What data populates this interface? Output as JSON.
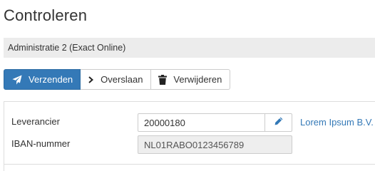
{
  "page": {
    "title": "Controleren"
  },
  "administration": {
    "label": "Administratie 2 (Exact Online)"
  },
  "toolbar": {
    "send_label": "Verzenden",
    "skip_label": "Overslaan",
    "delete_label": "Verwijderen",
    "send_icon": "paper-plane-icon",
    "skip_icon": "chevron-right-icon",
    "delete_icon": "trash-icon",
    "primary_color": "#3479b7"
  },
  "form": {
    "supplier": {
      "label": "Leverancier",
      "value": "20000180",
      "edit_icon": "pencil-icon",
      "link_text": "Lorem Ipsum B.V."
    },
    "iban": {
      "label": "IBAN-nummer",
      "value": "NL01RABO0123456789"
    }
  }
}
